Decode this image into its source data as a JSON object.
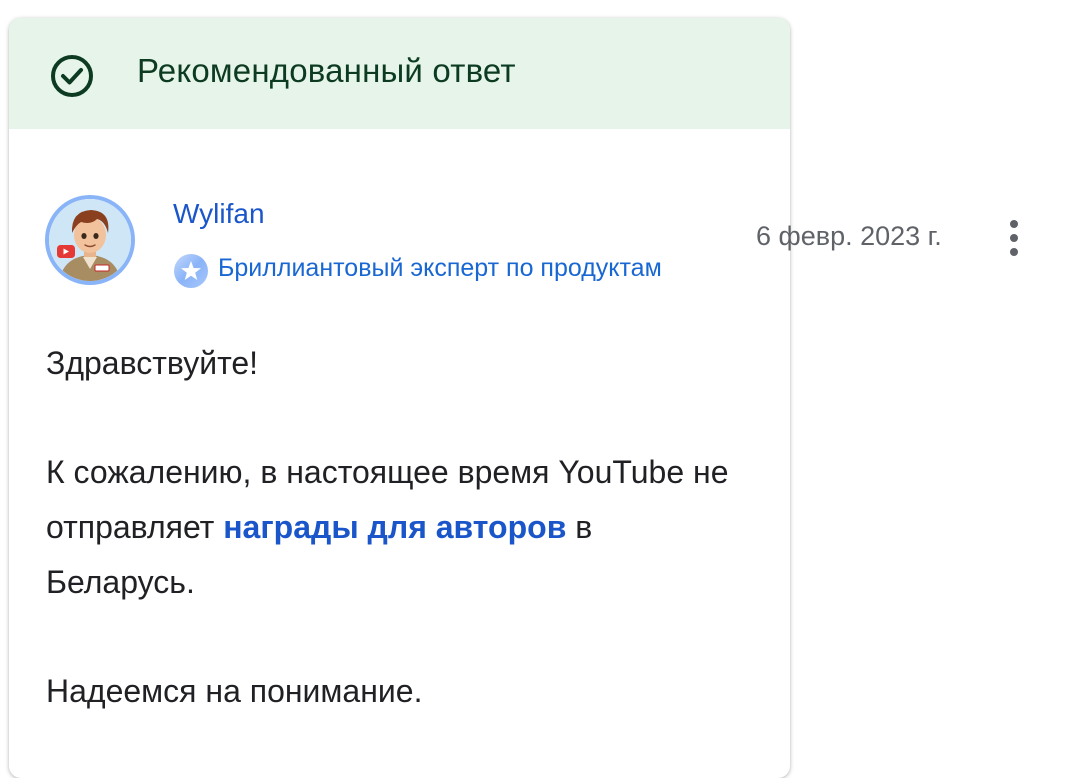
{
  "colors": {
    "header_bg": "#e6f4ea",
    "header_text": "#0d3b21",
    "link": "#1a56c9",
    "text": "#202124",
    "muted": "#5f6368"
  },
  "header": {
    "icon": "check-circle-icon",
    "title": "Рекомендованный ответ"
  },
  "author": {
    "name": "Wylifan",
    "avatar_icon": "avatar-illustration",
    "badge_icon": "diamond-expert-badge-icon",
    "badge_label": "Бриллиантовый эксперт по продуктам"
  },
  "post": {
    "date": "6 февр. 2023 г.",
    "more_icon": "more-vert-icon",
    "greeting": "Здравствуйте!",
    "paragraph2_before": "К сожалению, в настоящее время YouTube не отправляет ",
    "paragraph2_link": "награды для авторов",
    "paragraph2_after": " в Беларусь.",
    "closing": "Надеемся на понимание."
  }
}
